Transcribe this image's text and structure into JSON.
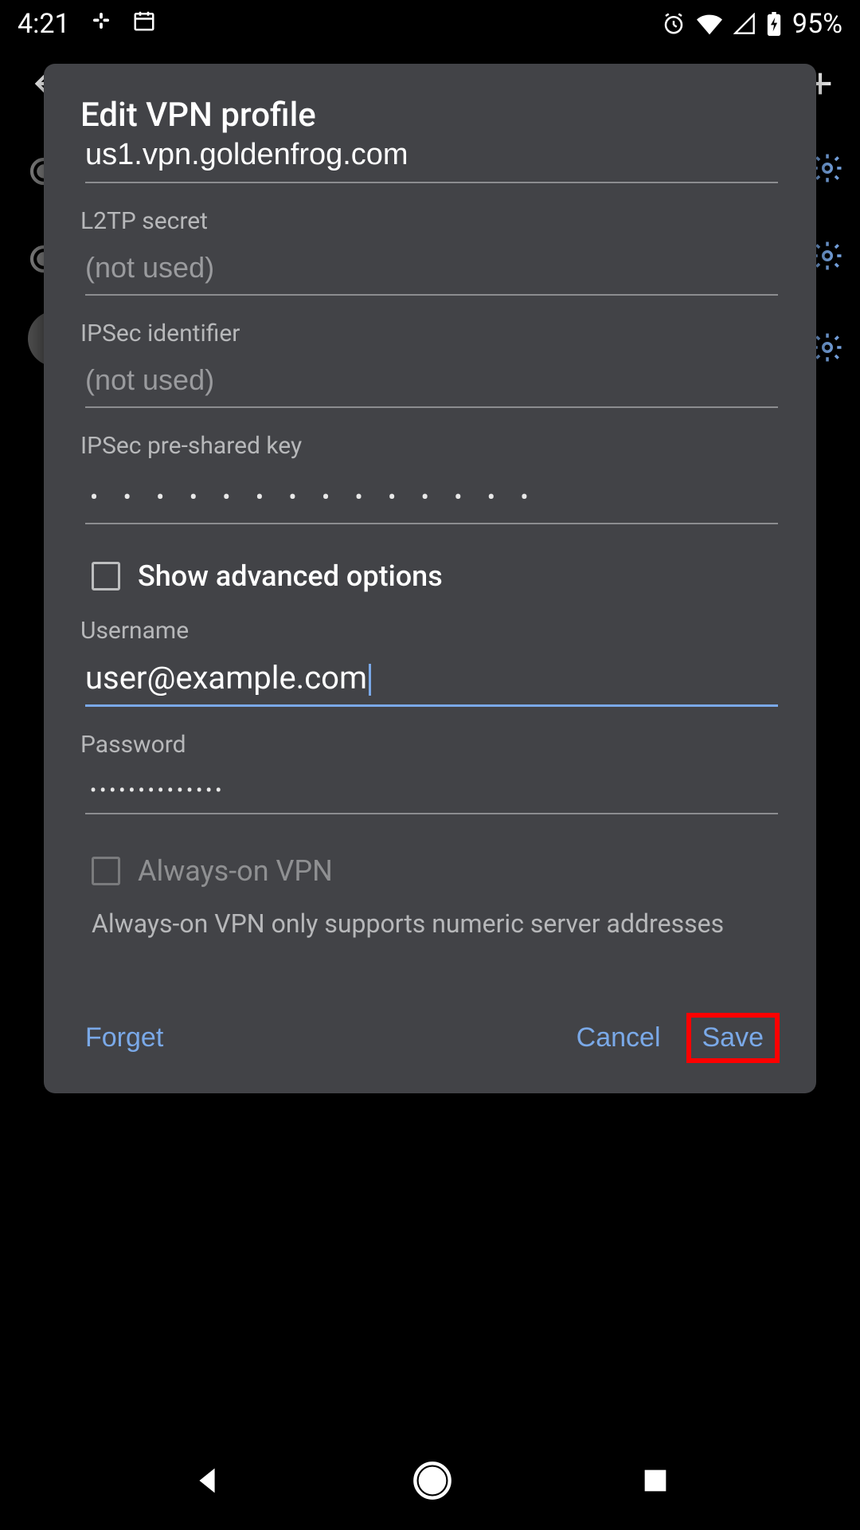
{
  "statusbar": {
    "time": "4:21",
    "battery_pct": "95%"
  },
  "dialog": {
    "title": "Edit VPN profile",
    "server_address": "us1.vpn.goldenfrog.com",
    "l2tp_secret_label": "L2TP secret",
    "l2tp_secret_placeholder": "(not used)",
    "l2tp_secret_value": "",
    "ipsec_identifier_label": "IPSec identifier",
    "ipsec_identifier_placeholder": "(not used)",
    "ipsec_identifier_value": "",
    "ipsec_psk_label": "IPSec pre-shared key",
    "ipsec_psk_mask": "•   •   •   •   •   •   •   •   •   •   •   •   •   •",
    "show_advanced_label": "Show advanced options",
    "show_advanced_checked": false,
    "username_label": "Username",
    "username_value": "user@example.com",
    "password_label": "Password",
    "password_mask": "••••••••••••••",
    "always_on_label": "Always-on VPN",
    "always_on_checked": false,
    "always_on_disabled": true,
    "always_on_help": "Always-on VPN only supports numeric server addresses",
    "buttons": {
      "forget": "Forget",
      "cancel": "Cancel",
      "save": "Save"
    }
  },
  "colors": {
    "accent": "#7aa9e8",
    "dialog_bg": "#424347",
    "highlight": "#ff0000"
  }
}
